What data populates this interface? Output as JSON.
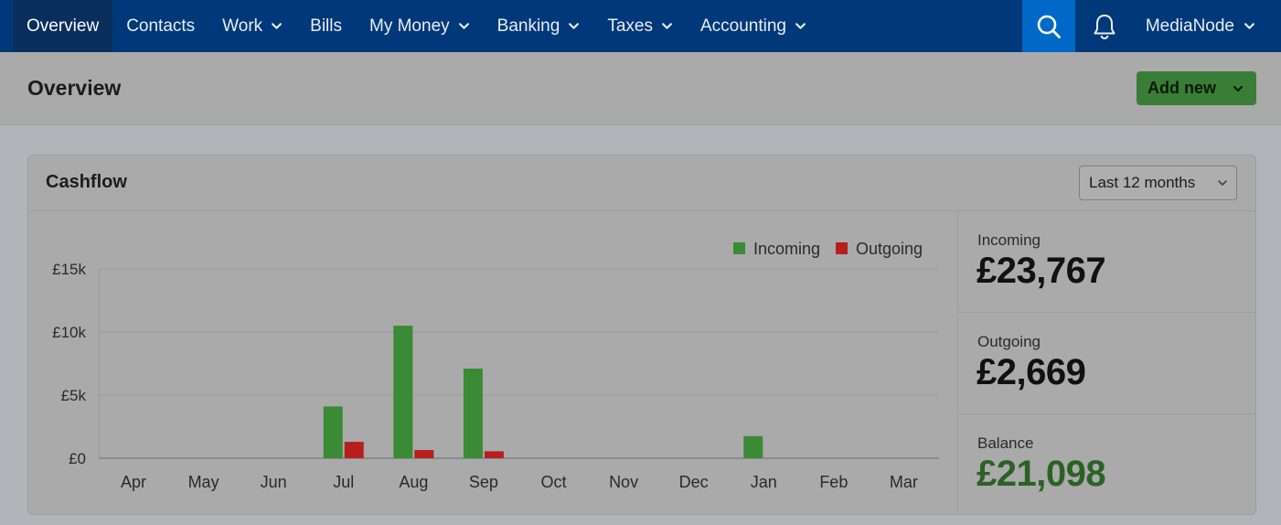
{
  "nav": {
    "items": [
      {
        "label": "Overview",
        "active": true,
        "dropdown": false
      },
      {
        "label": "Contacts",
        "active": false,
        "dropdown": false
      },
      {
        "label": "Work",
        "active": false,
        "dropdown": true
      },
      {
        "label": "Bills",
        "active": false,
        "dropdown": false
      },
      {
        "label": "My Money",
        "active": false,
        "dropdown": true
      },
      {
        "label": "Banking",
        "active": false,
        "dropdown": true
      },
      {
        "label": "Taxes",
        "active": false,
        "dropdown": true
      },
      {
        "label": "Accounting",
        "active": false,
        "dropdown": true
      }
    ],
    "account_name": "MediaNode",
    "search_icon": "search-icon",
    "bell_icon": "bell-icon"
  },
  "page": {
    "title": "Overview",
    "add_new_label": "Add new"
  },
  "cashflow": {
    "title": "Cashflow",
    "period_selected": "Last 12 months",
    "stats": {
      "incoming_label": "Incoming",
      "incoming_value": "£23,767",
      "outgoing_label": "Outgoing",
      "outgoing_value": "£2,669",
      "balance_label": "Balance",
      "balance_value": "£21,098"
    }
  },
  "colors": {
    "nav_bg": "#00397a",
    "search_bg": "#0069c8",
    "incoming": "#3b8a35",
    "outgoing": "#b81e1e",
    "add_new_bg": "#3a7d36",
    "balance_text": "#2c6126"
  },
  "chart_data": {
    "type": "bar",
    "categories": [
      "Apr",
      "May",
      "Jun",
      "Jul",
      "Aug",
      "Sep",
      "Oct",
      "Nov",
      "Dec",
      "Jan",
      "Feb",
      "Mar"
    ],
    "series": [
      {
        "name": "Incoming",
        "color": "#3b8a35",
        "values": [
          0,
          0,
          0,
          4100,
          10500,
          7100,
          0,
          0,
          0,
          1750,
          0,
          0
        ]
      },
      {
        "name": "Outgoing",
        "color": "#b81e1e",
        "values": [
          0,
          0,
          0,
          1300,
          650,
          550,
          0,
          0,
          0,
          0,
          0,
          0
        ]
      }
    ],
    "yticks": [
      {
        "value": 0,
        "label": "£0"
      },
      {
        "value": 5000,
        "label": "£5k"
      },
      {
        "value": 10000,
        "label": "£10k"
      },
      {
        "value": 15000,
        "label": "£15k"
      }
    ],
    "ylim": [
      0,
      15000
    ],
    "grid": true,
    "legend_position": "top-right"
  }
}
